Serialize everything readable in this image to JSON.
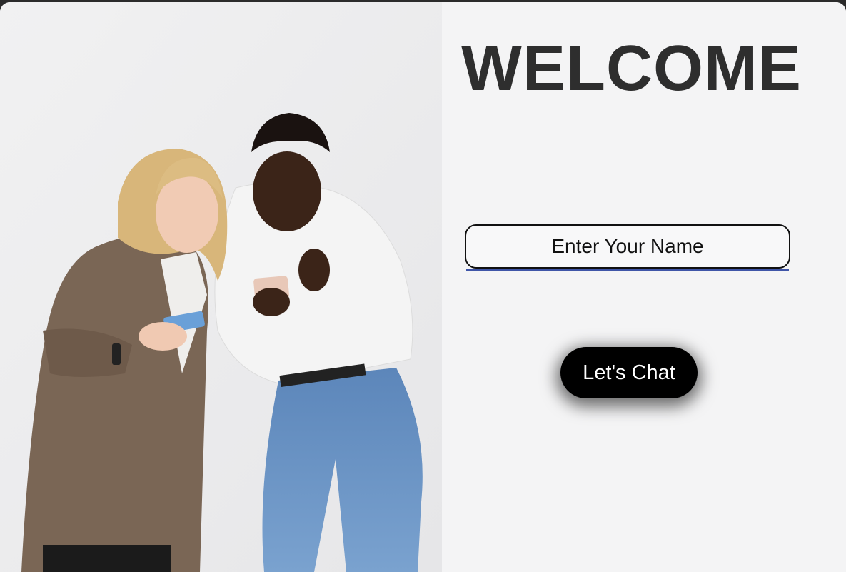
{
  "welcome": {
    "title": "WELCOME"
  },
  "form": {
    "name_placeholder": "Enter Your Name",
    "name_value": ""
  },
  "actions": {
    "chat_label": "Let's Chat"
  },
  "hero": {
    "image_name": "two-women-smartphones-photo"
  },
  "colors": {
    "title": "#2e2e2e",
    "underline_accent": "#3f55a8",
    "button_bg": "#000000",
    "button_text": "#ffffff",
    "panel_bg": "#f4f4f5"
  }
}
